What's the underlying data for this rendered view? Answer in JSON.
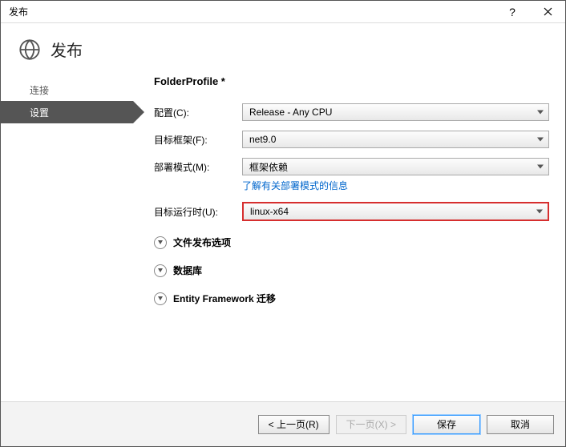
{
  "window": {
    "title": "发布"
  },
  "header": {
    "title": "发布"
  },
  "sidebar": {
    "items": [
      {
        "label": "连接",
        "selected": false
      },
      {
        "label": "设置",
        "selected": true
      }
    ]
  },
  "content": {
    "profile_title": "FolderProfile *",
    "fields": {
      "config": {
        "label": "配置(C):",
        "value": "Release - Any CPU"
      },
      "tfm": {
        "label": "目标框架(F):",
        "value": "net9.0"
      },
      "deploy": {
        "label": "部署模式(M):",
        "value": "框架依赖",
        "info_link": "了解有关部署模式的信息"
      },
      "runtime": {
        "label": "目标运行时(U):",
        "value": "linux-x64"
      }
    },
    "expanders": [
      {
        "label": "文件发布选项"
      },
      {
        "label": "数据库"
      },
      {
        "label": "Entity Framework 迁移"
      }
    ]
  },
  "footer": {
    "prev": "< 上一页(R)",
    "next": "下一页(X) >",
    "save": "保存",
    "cancel": "取消"
  }
}
